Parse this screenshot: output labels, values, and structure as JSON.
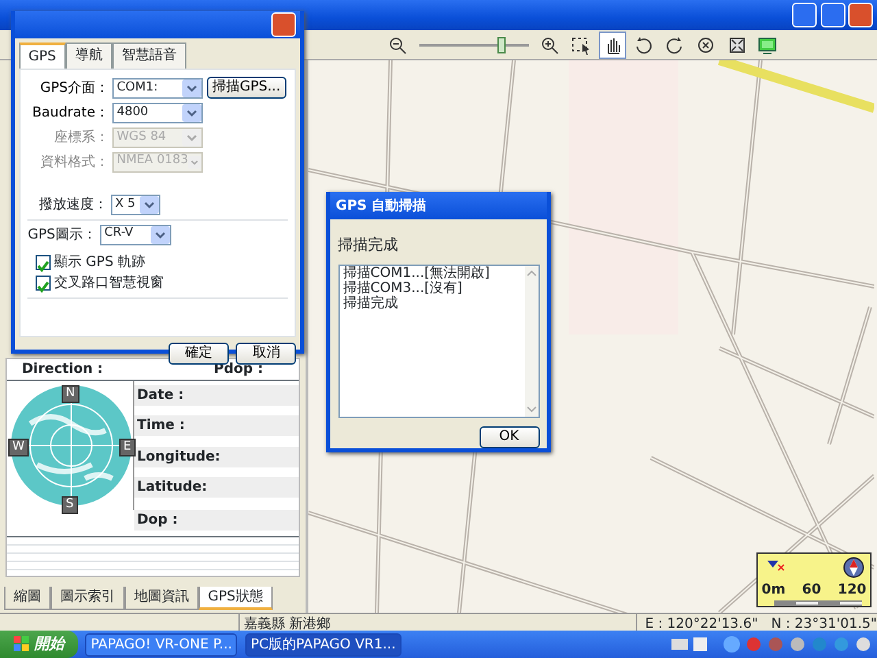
{
  "main_window": {
    "toolbar": {
      "zoom": {
        "level": 0.78
      },
      "tools": [
        {
          "selected": false
        },
        {
          "selected": true
        },
        {
          "selected": false
        },
        {
          "selected": false
        },
        {
          "selected": false
        },
        {
          "selected": false
        },
        {
          "selected": false
        }
      ]
    },
    "gps_panel": {
      "left_labels": [
        "Direction :"
      ],
      "right_labels": [
        "Pdop :"
      ],
      "info_labels": [
        "Date :",
        "Time :",
        "Longitude:",
        "Latitude:",
        "Dop :"
      ],
      "compass": [
        "N",
        "E",
        "S",
        "W"
      ]
    },
    "panel_tabs": [
      {
        "label": "縮圖",
        "selected": false
      },
      {
        "label": "圖示索引",
        "selected": false
      },
      {
        "label": "地圖資訊",
        "selected": false
      },
      {
        "label": "GPS狀態",
        "selected": true
      }
    ],
    "scale": {
      "labels": [
        "0m",
        "60",
        "120"
      ]
    },
    "status_bar": {
      "region": "嘉義縣 新港鄉",
      "coordinates": "E : 120°22'13.6\"   N : 23°31'01.5\""
    }
  },
  "settings_dialog": {
    "tabs": [
      {
        "label": "GPS",
        "selected": true
      },
      {
        "label": "導航",
        "selected": false
      },
      {
        "label": "智慧語音",
        "selected": false
      }
    ],
    "fields": [
      {
        "label": "GPS介面：",
        "value": "COM1:",
        "disabled": false
      },
      {
        "label": "Baudrate：",
        "value": "4800",
        "disabled": false
      },
      {
        "label": "座標系：",
        "value": "WGS 84",
        "disabled": true
      },
      {
        "label": "資料格式：",
        "value": "NMEA 0183",
        "disabled": true
      }
    ],
    "scan_button": "掃描GPS...",
    "playback": {
      "label": "撥放速度：",
      "value": "X 5"
    },
    "gps_icon": {
      "label": "GPS圖示：",
      "value": "CR-V"
    },
    "checkboxes": [
      {
        "label": "顯示 GPS 軌跡",
        "checked": true
      },
      {
        "label": "交叉路口智慧視窗",
        "checked": true
      }
    ],
    "buttons": [
      "確定",
      "取消"
    ]
  },
  "scan_dialog": {
    "title": "GPS 自動掃描",
    "message": "掃描完成",
    "log": [
      "掃描COM1...[無法開啟]",
      "掃描COM3...[沒有]",
      "掃描完成"
    ],
    "button": "OK"
  },
  "taskbar": {
    "start": "開始",
    "tasks": [
      {
        "label": "PAPAGO! VR-ONE P...",
        "selected": false
      },
      {
        "label": "PC版的PAPAGO VR1...",
        "selected": true
      }
    ]
  }
}
